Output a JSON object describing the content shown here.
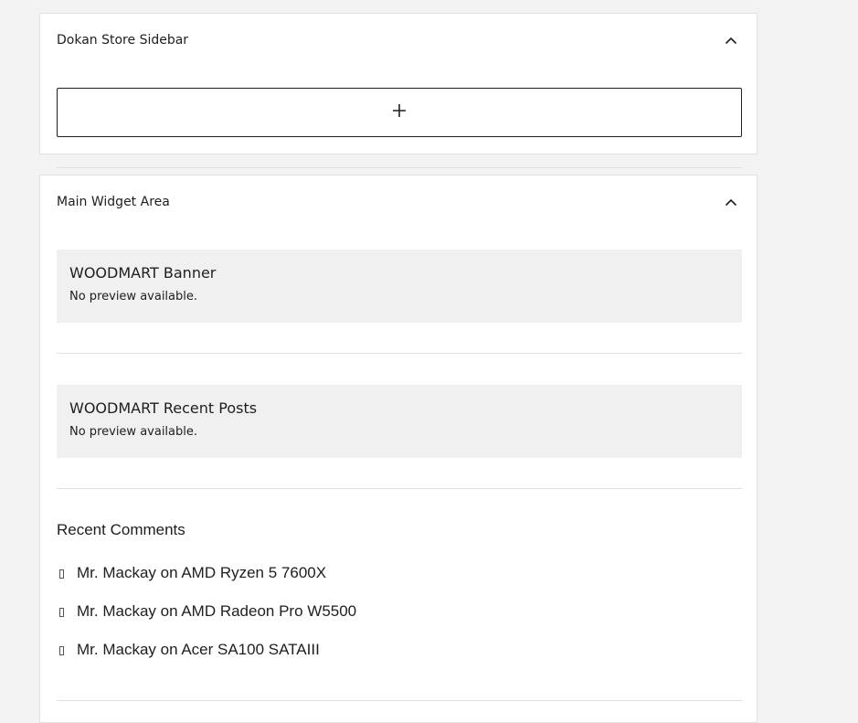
{
  "dokan_panel": {
    "title": "Dokan Store Sidebar",
    "add_block_icon": "plus-icon",
    "toggle_icon": "chevron-up-icon"
  },
  "main_panel": {
    "title": "Main Widget Area",
    "toggle_icon": "chevron-up-icon",
    "widgets": [
      {
        "title": "WOODMART Banner",
        "preview": "No preview available."
      },
      {
        "title": "WOODMART Recent Posts",
        "preview": "No preview available."
      }
    ],
    "recent_comments": {
      "heading": "Recent Comments",
      "bullet_icon": "missing-glyph-icon",
      "items": [
        {
          "text": "Mr. Mackay on AMD Ryzen 5 7600X"
        },
        {
          "text": "Mr. Mackay on AMD Radeon Pro W5500"
        },
        {
          "text": "Mr. Mackay on Acer SA100 SATAIII"
        }
      ]
    }
  },
  "colors": {
    "background": "#f3f3f3",
    "panel": "#ffffff",
    "widget_card": "#f0f0f0",
    "border": "#e0e0e0",
    "text": "#1e1e1e"
  }
}
